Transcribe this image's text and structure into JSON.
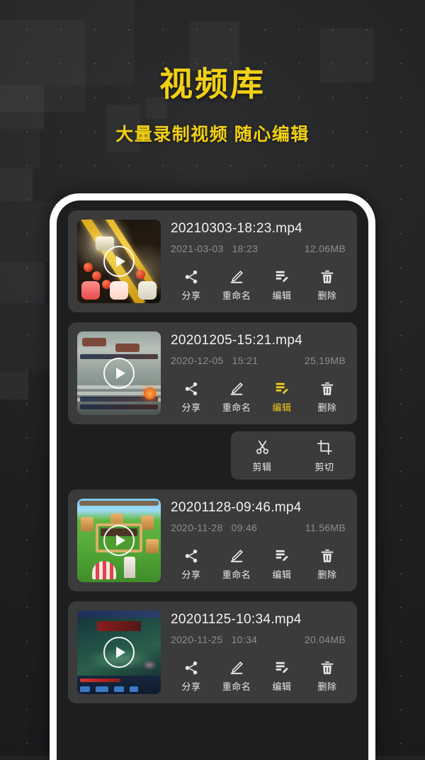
{
  "header": {
    "title": "视频库",
    "subtitle": "大量录制视频  随心编辑",
    "accent_color": "#F2D014"
  },
  "actions": {
    "share": "分享",
    "rename": "重命名",
    "edit": "编辑",
    "delete": "删除"
  },
  "edit_submenu": {
    "trim": "剪辑",
    "crop": "剪切"
  },
  "videos": [
    {
      "filename": "20210303-18:23.mp4",
      "date": "2021-03-03",
      "time": "18:23",
      "size": "12.06MB",
      "edit_active": false
    },
    {
      "filename": "20201205-15:21.mp4",
      "date": "2020-12-05",
      "time": "15:21",
      "size": "25.19MB",
      "edit_active": true
    },
    {
      "filename": "20201128-09:46.mp4",
      "date": "2020-11-28",
      "time": "09:46",
      "size": "11.56MB",
      "edit_active": false
    },
    {
      "filename": "20201125-10:34.mp4",
      "date": "2020-11-25",
      "time": "10:34",
      "size": "20.04MB",
      "edit_active": false
    }
  ]
}
